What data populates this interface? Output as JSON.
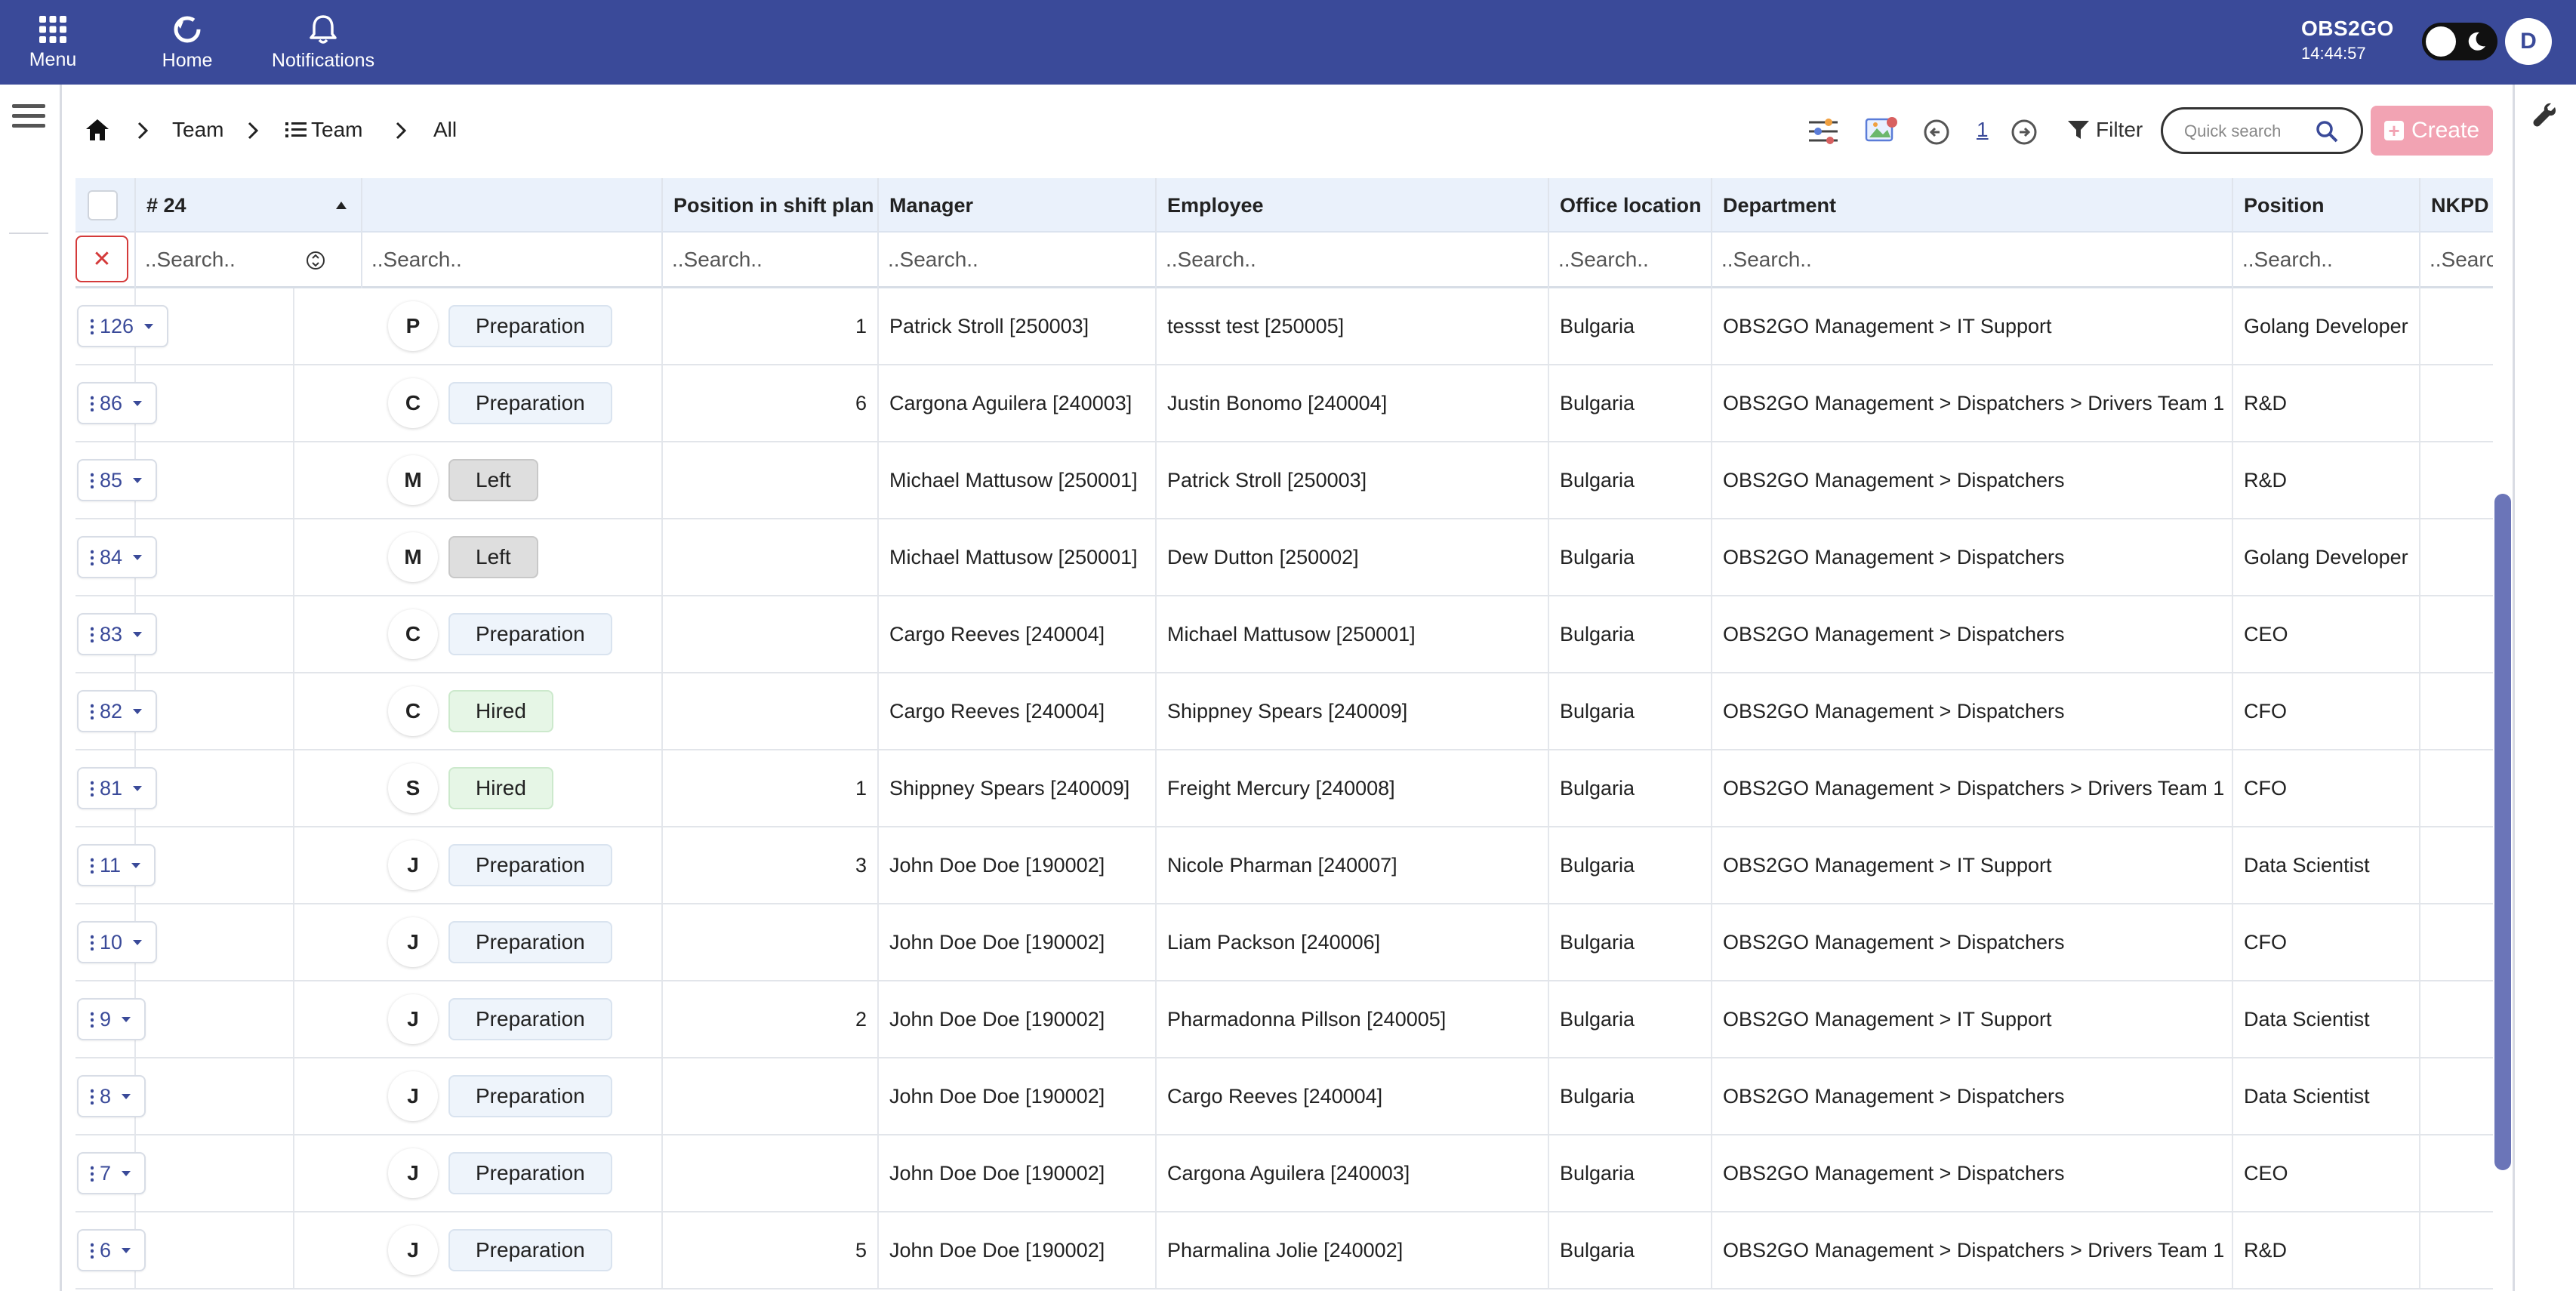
{
  "topbar": {
    "menu_label": "Menu",
    "home_label": "Home",
    "notifications_label": "Notifications",
    "brand": "OBS2GO",
    "clock": "14:44:57",
    "avatar_letter": "D",
    "bar_color": "#3a4a99"
  },
  "breadcrumb": {
    "item1": "Team",
    "item2": "Team",
    "item3": "All"
  },
  "toolbar": {
    "page_number": "1",
    "filter_label": "Filter",
    "quick_search_placeholder": "Quick search",
    "create_label": "Create",
    "create_color": "#f2a3b3"
  },
  "table": {
    "count_label": "# 24",
    "headers": {
      "position_in_shift_plan": "Position in shift plan",
      "manager": "Manager",
      "employee": "Employee",
      "office_location": "Office location",
      "department": "Department",
      "position": "Position",
      "nkpd": "NKPD"
    },
    "search_placeholder": "..Search..",
    "rows": [
      {
        "id": "126",
        "letter": "P",
        "status": "Preparation",
        "status_type": "prep",
        "shift_pos": "1",
        "manager": "Patrick Stroll [250003]",
        "employee": "tessst test [250005]",
        "office": "Bulgaria",
        "department": "OBS2GO Management > IT Support",
        "position": "Golang Developer",
        "nkpd": ""
      },
      {
        "id": "86",
        "letter": "C",
        "status": "Preparation",
        "status_type": "prep",
        "shift_pos": "6",
        "manager": "Cargona Aguilera [240003]",
        "employee": "Justin Bonomo [240004]",
        "office": "Bulgaria",
        "department": "OBS2GO Management > Dispatchers > Drivers Team 1",
        "position": "R&D",
        "nkpd": ""
      },
      {
        "id": "85",
        "letter": "M",
        "status": "Left",
        "status_type": "left",
        "shift_pos": "",
        "manager": "Michael Mattusow [250001]",
        "employee": "Patrick Stroll [250003]",
        "office": "Bulgaria",
        "department": "OBS2GO Management > Dispatchers",
        "position": "R&D",
        "nkpd": ""
      },
      {
        "id": "84",
        "letter": "M",
        "status": "Left",
        "status_type": "left",
        "shift_pos": "",
        "manager": "Michael Mattusow [250001]",
        "employee": "Dew Dutton [250002]",
        "office": "Bulgaria",
        "department": "OBS2GO Management > Dispatchers",
        "position": "Golang Developer",
        "nkpd": ""
      },
      {
        "id": "83",
        "letter": "C",
        "status": "Preparation",
        "status_type": "prep",
        "shift_pos": "",
        "manager": "Cargo Reeves [240004]",
        "employee": "Michael Mattusow [250001]",
        "office": "Bulgaria",
        "department": "OBS2GO Management > Dispatchers",
        "position": "CEO",
        "nkpd": ""
      },
      {
        "id": "82",
        "letter": "C",
        "status": "Hired",
        "status_type": "hired",
        "shift_pos": "",
        "manager": "Cargo Reeves [240004]",
        "employee": "Shippney Spears [240009]",
        "office": "Bulgaria",
        "department": "OBS2GO Management > Dispatchers",
        "position": "CFO",
        "nkpd": ""
      },
      {
        "id": "81",
        "letter": "S",
        "status": "Hired",
        "status_type": "hired",
        "shift_pos": "1",
        "manager": "Shippney Spears [240009]",
        "employee": "Freight Mercury [240008]",
        "office": "Bulgaria",
        "department": "OBS2GO Management > Dispatchers > Drivers Team 1",
        "position": "CFO",
        "nkpd": ""
      },
      {
        "id": "11",
        "letter": "J",
        "status": "Preparation",
        "status_type": "prep",
        "shift_pos": "3",
        "manager": "John Doe Doe [190002]",
        "employee": "Nicole Pharman [240007]",
        "office": "Bulgaria",
        "department": "OBS2GO Management > IT Support",
        "position": "Data Scientist",
        "nkpd": ""
      },
      {
        "id": "10",
        "letter": "J",
        "status": "Preparation",
        "status_type": "prep",
        "shift_pos": "",
        "manager": "John Doe Doe [190002]",
        "employee": "Liam Packson [240006]",
        "office": "Bulgaria",
        "department": "OBS2GO Management > Dispatchers",
        "position": "CFO",
        "nkpd": ""
      },
      {
        "id": "9",
        "letter": "J",
        "status": "Preparation",
        "status_type": "prep",
        "shift_pos": "2",
        "manager": "John Doe Doe [190002]",
        "employee": "Pharmadonna Pillson [240005]",
        "office": "Bulgaria",
        "department": "OBS2GO Management > IT Support",
        "position": "Data Scientist",
        "nkpd": ""
      },
      {
        "id": "8",
        "letter": "J",
        "status": "Preparation",
        "status_type": "prep",
        "shift_pos": "",
        "manager": "John Doe Doe [190002]",
        "employee": "Cargo Reeves [240004]",
        "office": "Bulgaria",
        "department": "OBS2GO Management > Dispatchers",
        "position": "Data Scientist",
        "nkpd": ""
      },
      {
        "id": "7",
        "letter": "J",
        "status": "Preparation",
        "status_type": "prep",
        "shift_pos": "",
        "manager": "John Doe Doe [190002]",
        "employee": "Cargona Aguilera [240003]",
        "office": "Bulgaria",
        "department": "OBS2GO Management > Dispatchers",
        "position": "CEO",
        "nkpd": ""
      },
      {
        "id": "6",
        "letter": "J",
        "status": "Preparation",
        "status_type": "prep",
        "shift_pos": "5",
        "manager": "John Doe Doe [190002]",
        "employee": "Pharmalina Jolie [240002]",
        "office": "Bulgaria",
        "department": "OBS2GO Management > Dispatchers > Drivers Team 1",
        "position": "R&D",
        "nkpd": ""
      }
    ]
  },
  "icons": {
    "menu": "grid-icon",
    "home": "refresh-circle-icon",
    "notifications": "bell-icon",
    "breadcrumb_home": "house-icon",
    "breadcrumb_list": "list-icon",
    "columns": "sliders-icon",
    "image": "image-icon",
    "prev": "arrow-left-circle-icon",
    "next": "arrow-right-circle-icon",
    "filter": "funnel-icon",
    "search": "magnifier-icon",
    "settings": "wrench-icon",
    "sidebar": "hamburger-icon"
  }
}
